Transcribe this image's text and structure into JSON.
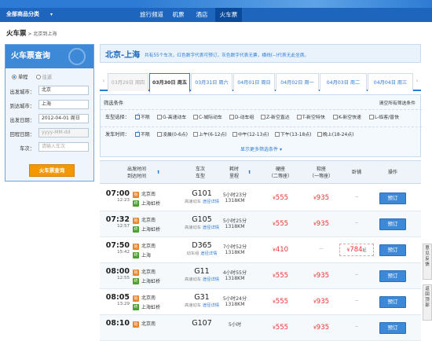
{
  "topnav": {
    "all_categories": "全部商品分类",
    "arrow": "▾",
    "items": [
      "旅行频道",
      "机票",
      "酒店",
      "火车票"
    ],
    "active_index": 3
  },
  "breadcrumb": {
    "title": "火车票",
    "sub": " > 北京到上海"
  },
  "search_panel": {
    "title": "火车票查询",
    "trip_types": [
      "单程",
      "往返"
    ],
    "selected_trip": 0,
    "from_label": "出发城市：",
    "from_value": "北京",
    "to_label": "到达城市：",
    "to_value": "上海",
    "depart_label": "出发日期：",
    "depart_value": "2012-04-01  周日",
    "return_label": "回程日期：",
    "return_placeholder": "yyyy-MM-dd",
    "train_label": "车次：",
    "train_placeholder": "请输入车次",
    "search_button": "火车票查询"
  },
  "route": {
    "title": "北京-上海",
    "info": "共有55个车次，红色数字代表可预订，灰色数字代表无票，横线(--)代表无此坐席。"
  },
  "date_tabs": {
    "prev": "‹",
    "next": "›",
    "tabs": [
      {
        "label": "03月29日 周四",
        "state": "past"
      },
      {
        "label": "03月30日 周五",
        "state": "active"
      },
      {
        "label": "03月31日 周六",
        "state": "normal"
      },
      {
        "label": "04月01日 周日",
        "state": "normal"
      },
      {
        "label": "04月02日 周一",
        "state": "normal"
      },
      {
        "label": "04月03日 周二",
        "state": "normal"
      },
      {
        "label": "04月04日 周三",
        "state": "normal"
      }
    ]
  },
  "filters": {
    "header": "筛选条件",
    "clear_all": "清空所有筛选条件",
    "type_label": "车型选择：",
    "type_options": [
      {
        "label": "不限",
        "checked": true
      },
      {
        "label": "G-高速动车",
        "checked": false
      },
      {
        "label": "C-城际动车",
        "checked": false
      },
      {
        "label": "D-动车组",
        "checked": false
      },
      {
        "label": "Z-新空直达",
        "checked": false
      },
      {
        "label": "T-新空特快",
        "checked": false
      },
      {
        "label": "K-新空快速",
        "checked": false
      },
      {
        "label": "L-临客/普快",
        "checked": false
      }
    ],
    "time_label": "发车时间：",
    "time_options": [
      {
        "label": "不限",
        "checked": true
      },
      {
        "label": "凌晨(0-6点)",
        "checked": false
      },
      {
        "label": "上午(6-12点)",
        "checked": false
      },
      {
        "label": "中午(12-13点)",
        "checked": false
      },
      {
        "label": "下午(13-18点)",
        "checked": false
      },
      {
        "label": "晚上(18-24点)",
        "checked": false
      }
    ],
    "more": "显示更多筛选条件 ▾"
  },
  "table": {
    "headers": {
      "time": "出发时间\n到达时间",
      "train": "车次\n车型",
      "duration": "耗时\n里程",
      "seat1": "硬座\n（二等座）",
      "seat2": "软座\n（一等座）",
      "sleeper": "卧铺",
      "action": "操作"
    },
    "sort_arrow": "⬆",
    "rows": [
      {
        "dep": "07:00",
        "arr": "12:23",
        "from": "北京南",
        "to": "上海虹桥",
        "from_badge": "始",
        "to_badge": "终",
        "train": "G101",
        "type": "高速动车",
        "link": "途径详情",
        "dur": "5小时23分",
        "dist": "1318KM",
        "p1": "555",
        "p2": "935",
        "p3": "--",
        "book": "预订"
      },
      {
        "dep": "07:32",
        "arr": "12:57",
        "from": "北京南",
        "to": "上海虹桥",
        "from_badge": "始",
        "to_badge": "终",
        "train": "G105",
        "type": "高速动车",
        "link": "途径详情",
        "dur": "5小时25分",
        "dist": "1318KM",
        "p1": "555",
        "p2": "935",
        "p3": "--",
        "book": "预订"
      },
      {
        "dep": "07:50",
        "arr": "15:42",
        "from": "北京南",
        "to": "上海",
        "from_badge": "始",
        "to_badge": "终",
        "train": "D365",
        "type": "动车组",
        "link": "途径详情",
        "dur": "7小时52分",
        "dist": "1318KM",
        "p1": "410",
        "p2": "--",
        "p3": "784",
        "p3_suffix": "起",
        "book": "预订"
      },
      {
        "dep": "08:00",
        "arr": "12:55",
        "from": "北京南",
        "to": "上海虹桥",
        "from_badge": "始",
        "to_badge": "终",
        "train": "G11",
        "type": "高速动车",
        "link": "途径详情",
        "dur": "4小时55分",
        "dist": "1318KM",
        "p1": "555",
        "p2": "935",
        "p3": "--",
        "book": "预订"
      },
      {
        "dep": "08:05",
        "arr": "13:29",
        "from": "北京南",
        "to": "上海虹桥",
        "from_badge": "始",
        "to_badge": "终",
        "train": "G31",
        "type": "高速动车",
        "link": "途径详情",
        "dur": "5小时24分",
        "dist": "1318KM",
        "p1": "555",
        "p2": "935",
        "p3": "--",
        "book": "预订"
      },
      {
        "dep": "08:10",
        "arr": "",
        "from": "北京南",
        "to": "",
        "from_badge": "始",
        "to_badge": "",
        "train": "G107",
        "type": "",
        "link": "",
        "dur": "5小时",
        "dist": "",
        "p1": "555",
        "p2": "935",
        "p3": "--",
        "book": "预订"
      }
    ]
  },
  "side_widget": {
    "feedback": "意见反馈",
    "top": "返回顶部"
  },
  "colors": {
    "brand": "#2d7bd4",
    "price": "#e33333",
    "button_orange": "#f39800"
  }
}
